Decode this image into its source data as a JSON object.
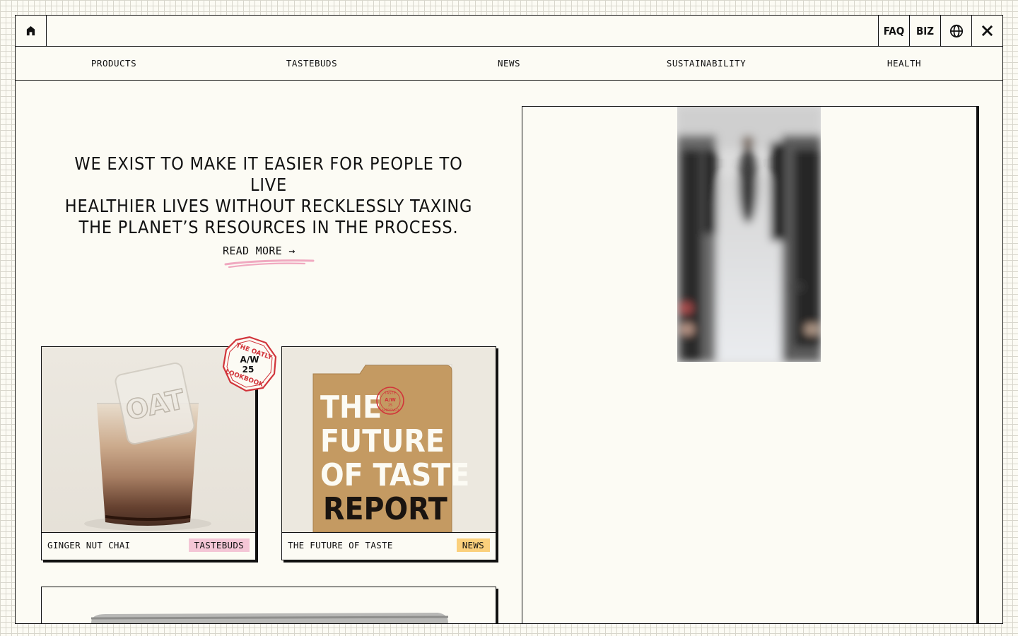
{
  "header": {
    "home_icon": "home-icon",
    "faq_label": "FAQ",
    "biz_label": "BIZ",
    "globe_icon": "globe-icon",
    "close_icon": "close-icon"
  },
  "nav": {
    "items": [
      {
        "label": "PRODUCTS"
      },
      {
        "label": "TASTEBUDS"
      },
      {
        "label": "NEWS"
      },
      {
        "label": "SUSTAINABILITY"
      },
      {
        "label": "HEALTH"
      }
    ]
  },
  "hero": {
    "lines": [
      "WE EXIST TO MAKE IT EASIER FOR PEOPLE TO LIVE",
      "HEALTHIER LIVES WITHOUT RECKLESSLY TAXING",
      "THE PLANET’S RESOURCES IN THE PROCESS."
    ],
    "read_more": "READ MORE",
    "arrow": "→"
  },
  "cards": [
    {
      "title": "GINGER NUT CHAI",
      "tag": "TASTEBUDS",
      "tag_color": "#f4c6d6",
      "stamp_text": "THE OATLY LOOKBOOK",
      "stamp_season": "A/W",
      "stamp_year": "25"
    },
    {
      "title": "THE FUTURE OF TASTE",
      "tag": "NEWS",
      "tag_color": "#fbd07c",
      "image_text": [
        "THE",
        "FUTURE",
        "OF TASTE",
        "REPORT"
      ],
      "image_stamp": [
        "TASTE",
        "A/W",
        "25",
        "APPROVED"
      ]
    }
  ],
  "colors": {
    "background": "#fcfbf4",
    "ink": "#111111",
    "accent_pink": "#f4c6d6",
    "accent_yellow": "#fbd07c",
    "stamp_red": "#d1343a"
  }
}
